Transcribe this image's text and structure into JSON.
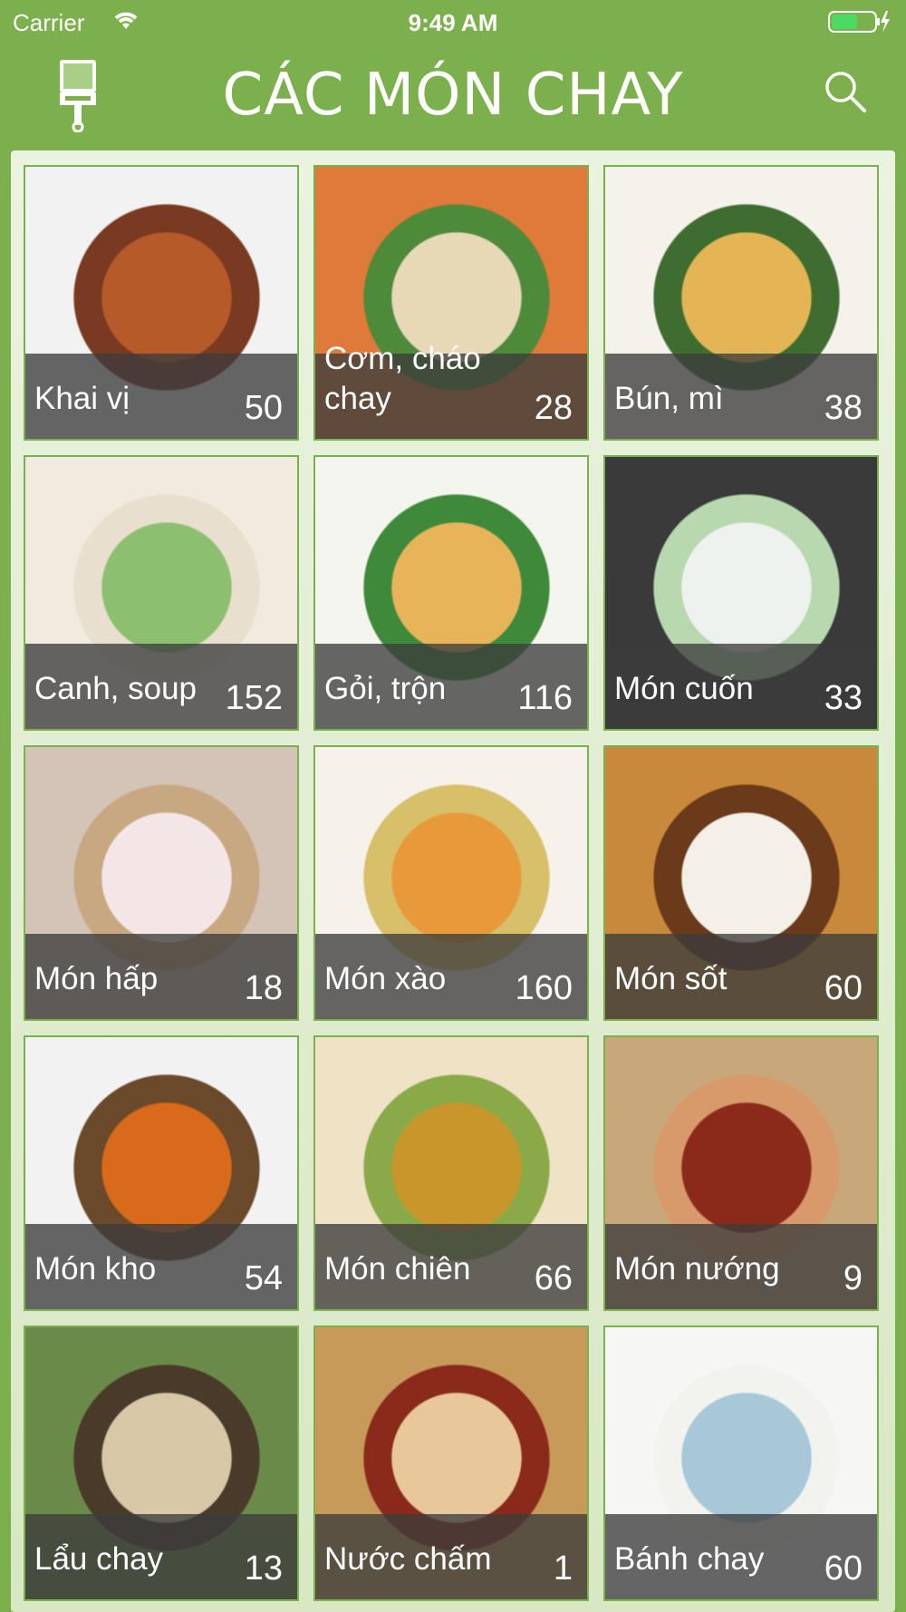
{
  "status_bar": {
    "carrier": "Carrier",
    "time": "9:49 AM"
  },
  "nav": {
    "logo_text": "CÁC MÓN CHAY",
    "left_icon": "paint-roller-icon",
    "right_icon": "search-icon"
  },
  "colors": {
    "brand_green": "#7cb04c",
    "overlay": "#3c3c3c"
  },
  "categories": [
    {
      "name": "Khai vị",
      "count": "50"
    },
    {
      "name": "Cơm, cháo chay",
      "count": "28"
    },
    {
      "name": "Bún, mì",
      "count": "38"
    },
    {
      "name": "Canh, soup",
      "count": "152"
    },
    {
      "name": "Gỏi, trộn",
      "count": "116"
    },
    {
      "name": "Món cuốn",
      "count": "33"
    },
    {
      "name": "Món hấp",
      "count": "18"
    },
    {
      "name": "Món xào",
      "count": "160"
    },
    {
      "name": "Món sốt",
      "count": "60"
    },
    {
      "name": "Món kho",
      "count": "54"
    },
    {
      "name": "Món chiên",
      "count": "66"
    },
    {
      "name": "Món nướng",
      "count": "9"
    },
    {
      "name": "Lẩu chay",
      "count": "13"
    },
    {
      "name": "Nước chấm",
      "count": "1"
    },
    {
      "name": "Bánh chay",
      "count": "60"
    }
  ]
}
